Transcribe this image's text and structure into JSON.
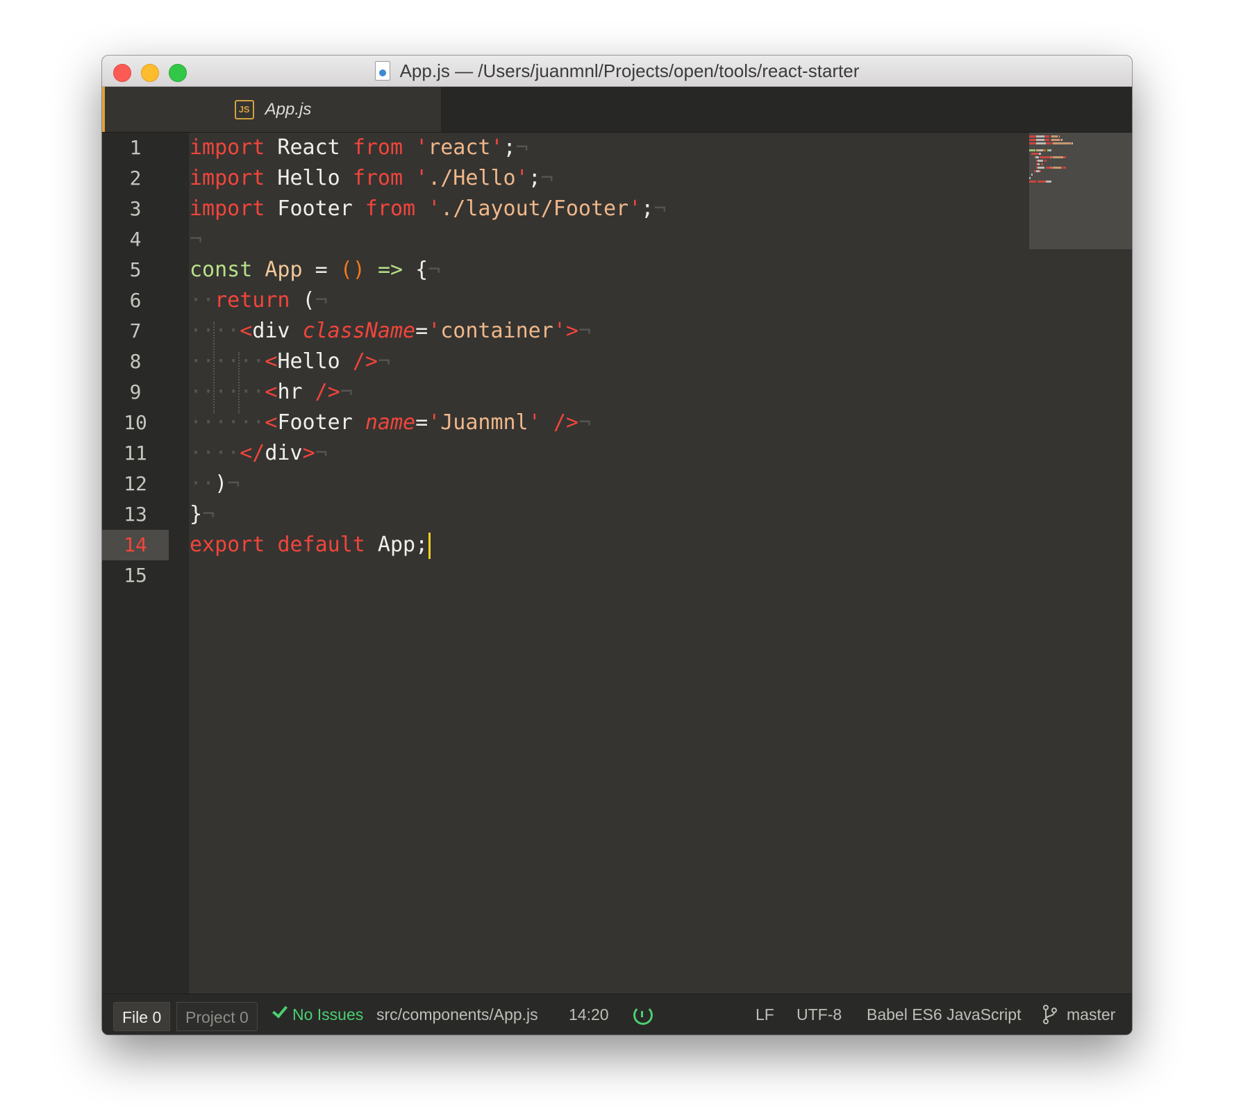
{
  "window": {
    "title": "App.js — /Users/juanmnl/Projects/open/tools/react-starter",
    "file_icon": "document-icon"
  },
  "tabs": [
    {
      "label": "App.js",
      "icon": "js-file-icon",
      "active": true
    }
  ],
  "editor": {
    "active_line": 14,
    "line_numbers": [
      "1",
      "2",
      "3",
      "4",
      "5",
      "6",
      "7",
      "8",
      "9",
      "10",
      "11",
      "12",
      "13",
      "14",
      "15"
    ],
    "lines": [
      [
        [
          "kw",
          "import"
        ],
        [
          "punc",
          " React "
        ],
        [
          "kw",
          "from"
        ],
        [
          "punc",
          " "
        ],
        [
          "q",
          "'"
        ],
        [
          "str",
          "react"
        ],
        [
          "q",
          "'"
        ],
        [
          "punc",
          ";"
        ],
        [
          "inv",
          "¬"
        ]
      ],
      [
        [
          "kw",
          "import"
        ],
        [
          "punc",
          " Hello "
        ],
        [
          "kw",
          "from"
        ],
        [
          "punc",
          " "
        ],
        [
          "q",
          "'"
        ],
        [
          "str",
          "./Hello"
        ],
        [
          "q",
          "'"
        ],
        [
          "punc",
          ";"
        ],
        [
          "inv",
          "¬"
        ]
      ],
      [
        [
          "kw",
          "import"
        ],
        [
          "punc",
          " Footer "
        ],
        [
          "kw",
          "from"
        ],
        [
          "punc",
          " "
        ],
        [
          "q",
          "'"
        ],
        [
          "str",
          "./layout/Footer"
        ],
        [
          "q",
          "'"
        ],
        [
          "punc",
          ";"
        ],
        [
          "inv",
          "¬"
        ]
      ],
      [
        [
          "inv",
          "¬"
        ]
      ],
      [
        [
          "cst",
          "const"
        ],
        [
          "punc",
          " "
        ],
        [
          "fn",
          "App"
        ],
        [
          "punc",
          " = "
        ],
        [
          "paren",
          "()"
        ],
        [
          "punc",
          " "
        ],
        [
          "op",
          "=>"
        ],
        [
          "punc",
          " {"
        ],
        [
          "inv",
          "¬"
        ]
      ],
      [
        [
          "inv",
          "··"
        ],
        [
          "kw",
          "return"
        ],
        [
          "punc",
          " ("
        ],
        [
          "inv",
          "¬"
        ]
      ],
      [
        [
          "inv",
          "····"
        ],
        [
          "kw",
          "<"
        ],
        [
          "tag",
          "div"
        ],
        [
          "punc",
          " "
        ],
        [
          "attr",
          "className"
        ],
        [
          "punc",
          "="
        ],
        [
          "q",
          "'"
        ],
        [
          "str",
          "container"
        ],
        [
          "q",
          "'"
        ],
        [
          "kw",
          ">"
        ],
        [
          "inv",
          "¬"
        ]
      ],
      [
        [
          "inv",
          "······"
        ],
        [
          "kw",
          "<"
        ],
        [
          "tag",
          "Hello"
        ],
        [
          "punc",
          " "
        ],
        [
          "kw",
          "/>"
        ],
        [
          "inv",
          "¬"
        ]
      ],
      [
        [
          "inv",
          "······"
        ],
        [
          "kw",
          "<"
        ],
        [
          "tag",
          "hr"
        ],
        [
          "punc",
          " "
        ],
        [
          "kw",
          "/>"
        ],
        [
          "inv",
          "¬"
        ]
      ],
      [
        [
          "inv",
          "······"
        ],
        [
          "kw",
          "<"
        ],
        [
          "tag",
          "Footer"
        ],
        [
          "punc",
          " "
        ],
        [
          "attr",
          "name"
        ],
        [
          "punc",
          "="
        ],
        [
          "q",
          "'"
        ],
        [
          "str",
          "Juanmnl"
        ],
        [
          "q",
          "'"
        ],
        [
          "punc",
          " "
        ],
        [
          "kw",
          "/>"
        ],
        [
          "inv",
          "¬"
        ]
      ],
      [
        [
          "inv",
          "····"
        ],
        [
          "kw",
          "</"
        ],
        [
          "tag",
          "div"
        ],
        [
          "kw",
          ">"
        ],
        [
          "inv",
          "¬"
        ]
      ],
      [
        [
          "inv",
          "··"
        ],
        [
          "punc",
          ")"
        ],
        [
          "inv",
          "¬"
        ]
      ],
      [
        [
          "punc",
          "}"
        ],
        [
          "inv",
          "¬"
        ]
      ],
      [
        [
          "kw",
          "export"
        ],
        [
          "punc",
          " "
        ],
        [
          "kw",
          "default"
        ],
        [
          "punc",
          " App;"
        ]
      ],
      []
    ]
  },
  "statusbar": {
    "file_label": "File",
    "file_count": "0",
    "project_label": "Project",
    "project_count": "0",
    "lint_status": "No Issues",
    "file_path": "src/components/App.js",
    "cursor_position": "14:20",
    "line_ending": "LF",
    "encoding": "UTF-8",
    "grammar": "Babel ES6 JavaScript",
    "branch": "master"
  },
  "colors": {
    "keyword": "#f2453b",
    "string": "#f0b78a",
    "const": "#b8e08a",
    "paren": "#f07a1f",
    "cursor": "#f5d224",
    "tab_accent": "#e0a23a",
    "ok": "#4ccf73"
  }
}
